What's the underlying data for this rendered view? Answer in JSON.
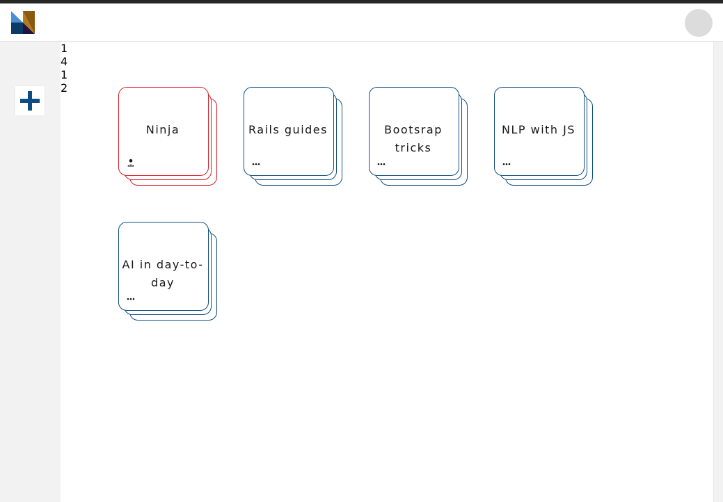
{
  "colors": {
    "accent": "#0f4c81",
    "alert": "#da1e28"
  },
  "header": {
    "logo_icon": "brand-logo-icon",
    "avatar_icon": "user-avatar-icon"
  },
  "sidebar": {
    "add_icon": "plus-icon"
  },
  "decks": [
    {
      "title": "Ninja",
      "badge": "",
      "icon": "user-lock-icon",
      "variant": "alert"
    },
    {
      "title": "Rails guides",
      "badge": "1",
      "icon": "more-dots-icon",
      "variant": "normal"
    },
    {
      "title": "Bootsrap tricks",
      "badge": "4",
      "icon": "more-dots-icon",
      "variant": "normal"
    },
    {
      "title": "NLP with JS",
      "badge": "1",
      "icon": "more-dots-icon",
      "variant": "normal"
    },
    {
      "title": "AI in day-to-day",
      "badge": "2",
      "icon": "more-dots-icon",
      "variant": "normal"
    }
  ]
}
